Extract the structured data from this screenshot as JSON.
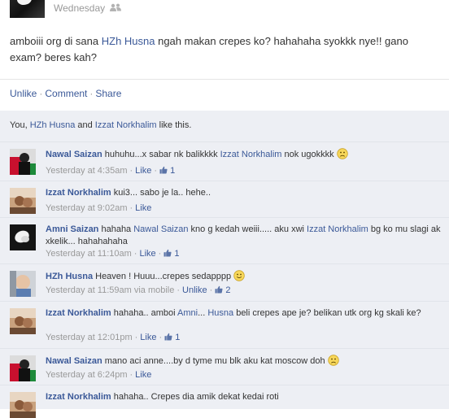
{
  "story": {
    "date": "Wednesday",
    "audience_icon": "friends-icon",
    "text_before": "amboiii org di sana ",
    "text_link": "HZh Husna",
    "text_after": " ngah makan crepes ko? hahahaha syokkk nye!! gano exam? beres kah?"
  },
  "actions": {
    "unlike": "Unlike",
    "comment": "Comment",
    "share": "Share",
    "separator": "·"
  },
  "likes": {
    "you": "You, ",
    "person1": "HZh Husna",
    "and": " and ",
    "person2": "Izzat Norkhalim",
    "suffix": " like this."
  },
  "comments": [
    {
      "author": "Nawal Saizan",
      "parts": [
        {
          "t": "text",
          "v": "huhuhu...x sabar nk balikkkk "
        },
        {
          "t": "link",
          "v": "Izzat Norkhalim"
        },
        {
          "t": "text",
          "v": " nok ugokkkk "
        },
        {
          "t": "smiley",
          "v": "sad"
        }
      ],
      "time": "Yesterday at 4:35am",
      "action": "Like",
      "likes": "1",
      "avatar": "flag-red-green"
    },
    {
      "author": "Izzat Norkhalim",
      "parts": [
        {
          "t": "text",
          "v": "kui3... sabo je la.. hehe.."
        }
      ],
      "time": "Yesterday at 9:02am",
      "action": "Like",
      "likes": "",
      "avatar": "photo-warm"
    },
    {
      "author": "Amni Saizan",
      "parts": [
        {
          "t": "text",
          "v": "hahaha "
        },
        {
          "t": "link",
          "v": "Nawal Saizan"
        },
        {
          "t": "text",
          "v": " kno g kedah weiii..... aku xwi "
        },
        {
          "t": "link",
          "v": "Izzat Norkhalim"
        },
        {
          "t": "text",
          "v": " bg ko mu slagi ak xkelik... hahahahaha"
        }
      ],
      "time": "Yesterday at 11:10am",
      "action": "Like",
      "likes": "1",
      "avatar": "flower-dark"
    },
    {
      "author": "HZh Husna",
      "parts": [
        {
          "t": "text",
          "v": "Heaven ! Huuu...crepes sedapppp "
        },
        {
          "t": "smiley",
          "v": "happy"
        }
      ],
      "time": "Yesterday at 11:59am via mobile",
      "action": "Unlike",
      "likes": "2",
      "avatar": "photo-child"
    },
    {
      "author": "Izzat Norkhalim",
      "parts": [
        {
          "t": "text",
          "v": "hahaha.. amboi "
        },
        {
          "t": "link",
          "v": "Amni"
        },
        {
          "t": "text",
          "v": "... "
        },
        {
          "t": "link",
          "v": "Husna"
        },
        {
          "t": "text",
          "v": " beli crepes ape je? belikan utk org kg skali ke?"
        }
      ],
      "time": "Yesterday at 12:01pm",
      "action": "Like",
      "likes": "1",
      "avatar": "photo-warm"
    },
    {
      "author": "Nawal Saizan",
      "parts": [
        {
          "t": "text",
          "v": "mano aci anne....by d tyme mu blk aku kat moscow doh "
        },
        {
          "t": "smiley",
          "v": "sad"
        }
      ],
      "time": "Yesterday at 6:24pm",
      "action": "Like",
      "likes": "",
      "avatar": "flag-red-green"
    }
  ],
  "partial_comment": {
    "author": "Izzat Norkhalim",
    "text": "hahaha.. Crepes dia amik dekat kedai roti"
  }
}
